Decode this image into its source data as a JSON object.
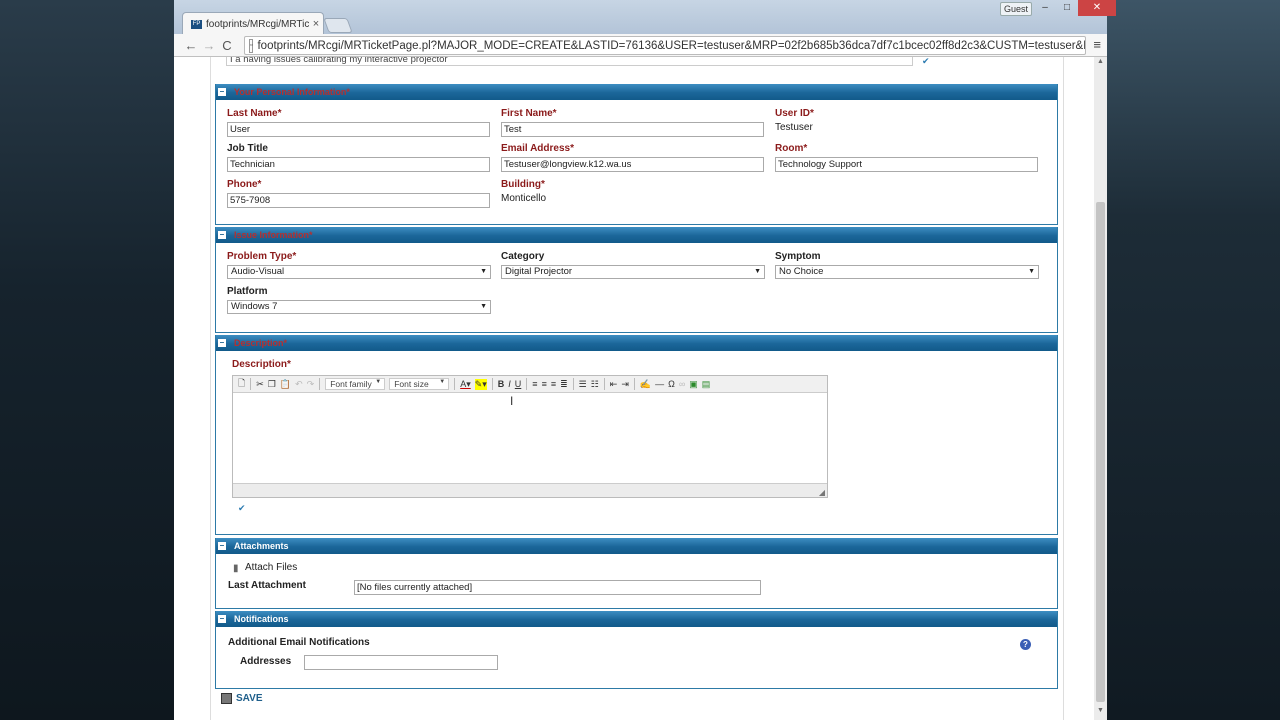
{
  "browser": {
    "tab_title": "footprints/MRcgi/MRTicke",
    "tab_close": "×",
    "favicon_text": "FP",
    "guest_label": "Guest",
    "win_min": "–",
    "win_max": "□",
    "win_close": "✕",
    "back": "←",
    "forward": "→",
    "reload": "C",
    "url": "footprints/MRcgi/MRTicketPage.pl?MAJOR_MODE=CREATE&LASTID=76136&USER=testuser&MRP=02f2b685b36dca7df7c1bcec02ff8d2c3&CUSTM=testuser&NEV",
    "menu": "≡"
  },
  "top_field": "I a having issues calibrating my interactive projector",
  "sections": {
    "personal": {
      "title": "Your Personal Information*",
      "last_name_label": "Last Name*",
      "last_name_value": "User",
      "first_name_label": "First Name*",
      "first_name_value": "Test",
      "user_id_label": "User ID*",
      "user_id_value": "Testuser",
      "job_title_label": "Job Title",
      "job_title_value": "Technician",
      "email_label": "Email Address*",
      "email_value": "Testuser@longview.k12.wa.us",
      "room_label": "Room*",
      "room_value": "Technology Support",
      "phone_label": "Phone*",
      "phone_value": "575-7908",
      "building_label": "Building*",
      "building_value": "Monticello"
    },
    "issue": {
      "title": "Issue Information*",
      "problem_type_label": "Problem Type*",
      "problem_type_value": "Audio-Visual",
      "category_label": "Category",
      "category_value": "Digital Projector",
      "symptom_label": "Symptom",
      "symptom_value": "No Choice",
      "platform_label": "Platform",
      "platform_value": "Windows 7"
    },
    "description": {
      "title": "Description*",
      "field_label": "Description*",
      "font_family": "Font family",
      "font_size": "Font size"
    },
    "attachments": {
      "title": "Attachments",
      "attach_files": "Attach Files",
      "last_attachment_label": "Last Attachment",
      "last_attachment_value": "[No files currently attached]"
    },
    "notifications": {
      "title": "Notifications",
      "additional_label": "Additional Email Notifications",
      "addresses_label": "Addresses",
      "addresses_value": ""
    }
  },
  "save_label": "SAVE",
  "colors": {
    "section_header": "#1b6699",
    "required_label": "#8b1a1a",
    "save_text": "#1f5f8b"
  }
}
